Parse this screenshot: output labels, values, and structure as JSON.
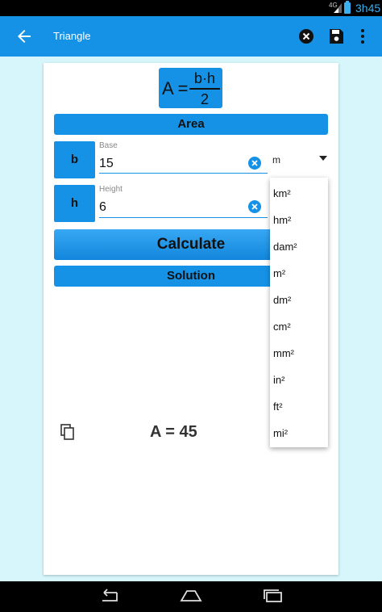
{
  "status": {
    "network": "4G",
    "time": "3h45"
  },
  "appbar": {
    "title": "Triangle"
  },
  "formula": {
    "lhs": "A =",
    "numerator": "b·h",
    "denominator": "2"
  },
  "section_area": "Area",
  "fields": [
    {
      "var": "b",
      "label": "Base",
      "value": "15"
    },
    {
      "var": "h",
      "label": "Height",
      "value": "6"
    }
  ],
  "unit_selected": "m",
  "unit_options": [
    "km²",
    "hm²",
    "dam²",
    "m²",
    "dm²",
    "cm²",
    "mm²",
    "in²",
    "ft²",
    "mi²"
  ],
  "calculate_label": "Calculate",
  "section_solution": "Solution",
  "result": "A = 45"
}
